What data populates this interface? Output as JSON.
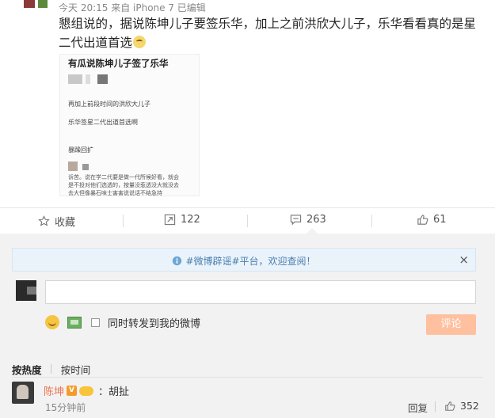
{
  "post": {
    "meta": "今天 20:15 来自 iPhone 7  已编辑",
    "content": "懇组说的，据说陈坤儿子要签乐华，加上之前洪欣大儿子，乐华看看真的是星二代出道首选",
    "image": {
      "title": "有瓜说陈坤儿子签了乐华",
      "line1": "再加上前段时间的洪欣大儿子",
      "line2": "乐华签星二代出道首选啊",
      "line3": "暴躁回扩",
      "small1": "诉苦。说在学二代要是做一代所候好看，就会",
      "small2": "是不投对他们选透的，按量没惹透没大就没去",
      "small3": "去大但像暴石味士害害说说话不结急持"
    }
  },
  "actions": {
    "favorite_label": "收藏",
    "repost_count": "122",
    "comment_count": "263",
    "like_count": "61"
  },
  "comment_panel": {
    "notice_text": "#微博辟谣#平台，欢迎查阅！",
    "input_placeholder": "",
    "sync_label": "同时转发到我的微博",
    "submit_label": "评论",
    "sort_hot": "按热度",
    "sort_time": "按时间"
  },
  "comments": [
    {
      "name": "陈坤",
      "badge": "V",
      "text": "：胡扯",
      "time": "15分钟前",
      "reply_label": "回复",
      "like_count": "352"
    }
  ],
  "colors": {
    "name_orange": "#eb7350",
    "submit_disabled": "#ffc09f",
    "notice_blue": "#4a7fb0"
  }
}
